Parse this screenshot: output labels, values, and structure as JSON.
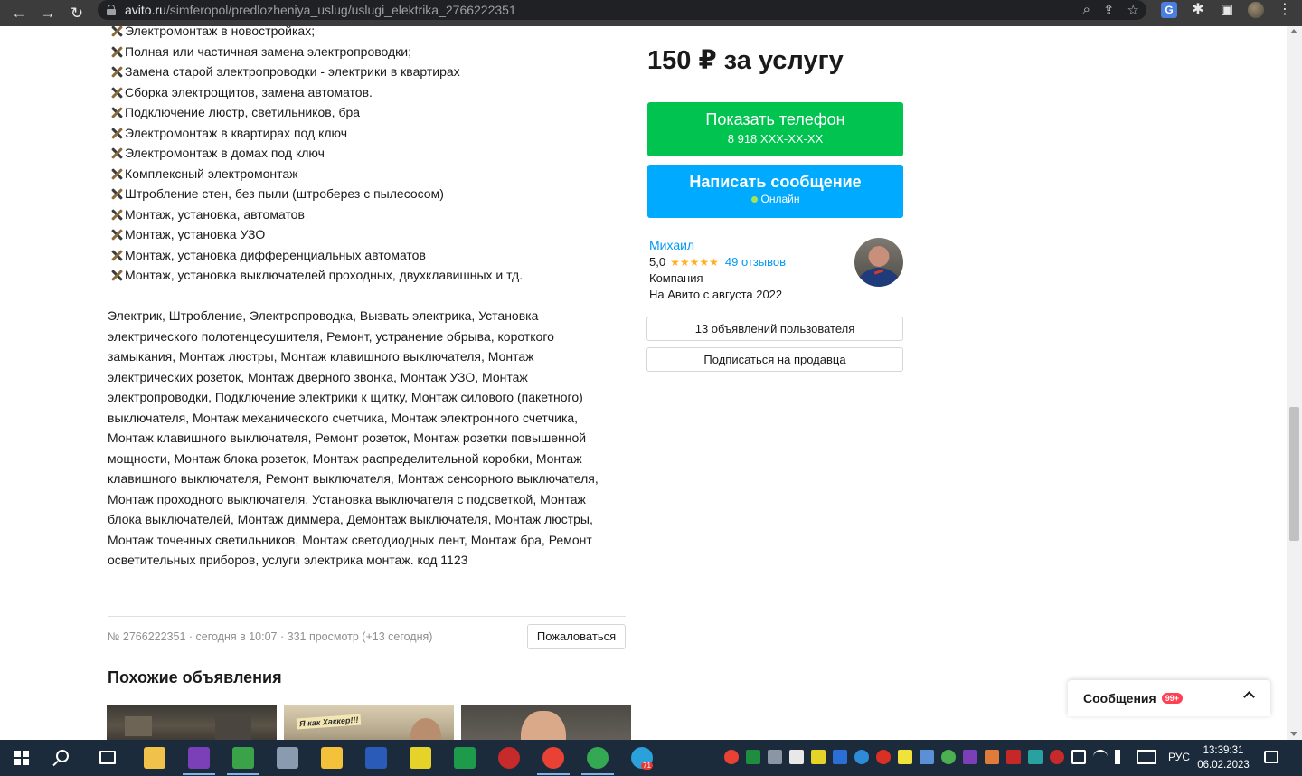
{
  "browser": {
    "url_host": "avito.ru",
    "url_path": "/simferopol/predlozheniya_uslug/uslugi_elektrika_2766222351"
  },
  "listing": {
    "features": [
      "Электромонтаж в новостройках;",
      "Полная или частичная замена электропроводки;",
      "Замена старой электропроводки - электрики в квартирах",
      "Сборка электрощитов, замена автоматов.",
      "Подключение люстр, светильников, бра",
      "Электромонтаж в квартирах под ключ",
      "Электромонтаж в домах под ключ",
      "Комплексный электромонтаж",
      "Штробление стен, без пыли (штроберез с пылесосом)",
      "Монтаж, установка, автоматов",
      "Монтаж, установка УЗО",
      "Монтаж, установка дифференциальных автоматов",
      "Монтаж, установка выключателей проходных, двухклавишных и тд."
    ],
    "tags_text": "Электрик, Штробление, Электропроводка, Вызвать электрика, Установка электрического полотенцесушителя, Ремонт, устранение обрыва, короткого замыкания, Монтаж люстры, Монтаж клавишного выключателя, Монтаж электрических розеток, Монтаж дверного звонка, Монтаж УЗО, Монтаж электропроводки, Подключение электрики к щитку, Монтаж силового (пакетного) выключателя, Монтаж механического счетчика, Монтаж электронного счетчика, Монтаж клавишного выключателя, Ремонт розеток, Монтаж розетки повышенной мощности, Монтаж блока розеток, Монтаж распределительной коробки, Монтаж клавишного выключателя, Ремонт выключателя, Монтаж сенсорного выключателя, Монтаж проходного выключателя, Установка выключателя с подсветкой, Монтаж блока выключателей, Монтаж диммера, Демонтаж выключателя, Монтаж люстры, Монтаж точечных светильников, Монтаж светодиодных лент, Монтаж бра, Ремонт осветительных приборов, услуги электрика монтаж. код 1123",
    "meta": "№ 2766222351 · сегодня в 10:07 · 331 просмотр (+13 сегодня)",
    "report_label": "Пожаловаться",
    "similar_title": "Похожие объявления",
    "thumb2_caption": "Я как Хаккер!!!"
  },
  "sidebar": {
    "price": "150 ₽ за услугу",
    "phone_button": "Показать телефон",
    "phone_number": "8 918 XXX-XX-XX",
    "message_button": "Написать сообщение",
    "online_status": "Онлайн",
    "seller_name": "Михаил",
    "rating_value": "5,0",
    "stars": "★★★★★",
    "reviews": "49 отзывов",
    "seller_type": "Компания",
    "seller_since": "На Авито с августа 2022",
    "user_ads_button": "13 объявлений пользователя",
    "subscribe_button": "Подписаться на продавца"
  },
  "messages_widget": {
    "label": "Сообщения",
    "badge": "99+"
  },
  "taskbar": {
    "language": "РУС",
    "time": "13:39:31",
    "date": "06.02.2023",
    "telegram_badge": "71"
  },
  "colors": {
    "green_button": "#00c44f",
    "blue_button": "#00aaff",
    "link": "#0099f7",
    "stars": "#ffb021",
    "badge": "#ff4053"
  }
}
